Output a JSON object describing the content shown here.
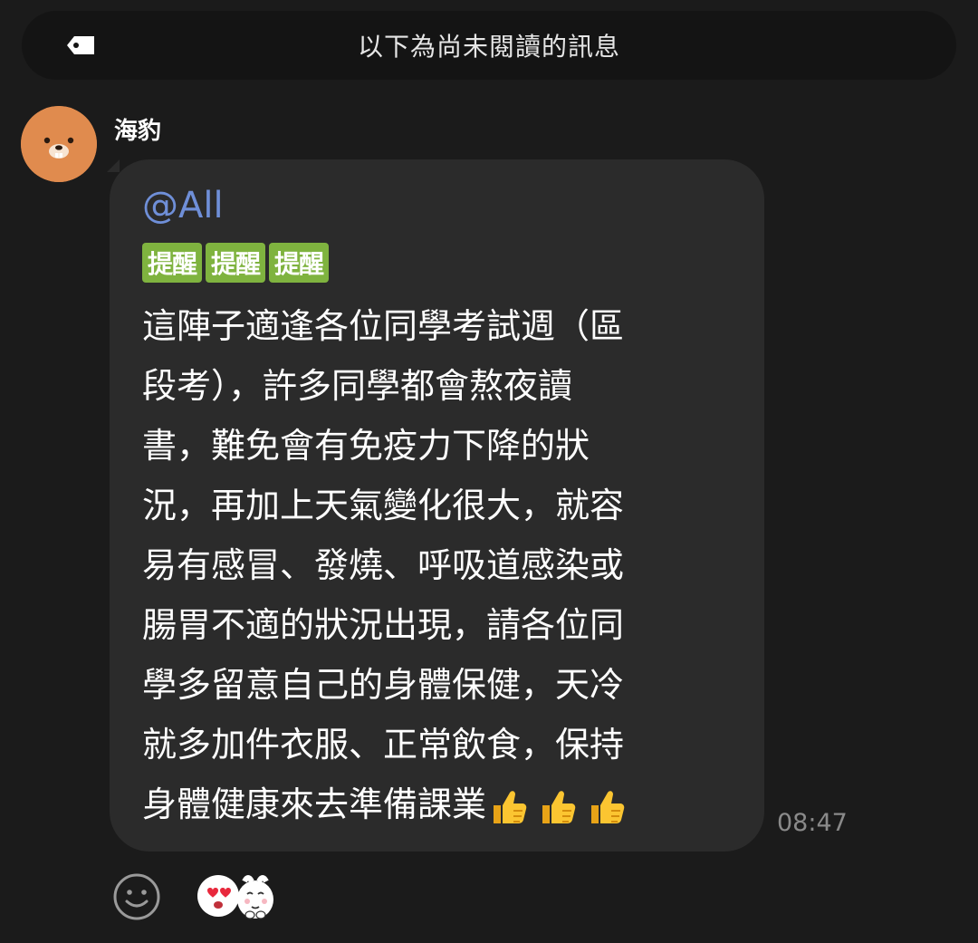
{
  "unread_banner": {
    "text": "以下為尚未閱讀的訊息",
    "icon": "tag-icon"
  },
  "message": {
    "sender": "海豹",
    "avatar_icon": "seal-avatar",
    "mention": "@All",
    "reminder_badges": [
      "提醒",
      "提醒",
      "提醒"
    ],
    "body_lines": [
      "這陣子適逢各位同學考試週（區",
      "段考），許多同學都會熬夜讀",
      "書，難免會有免疫力下降的狀",
      "況，再加上天氣變化很大，就容",
      "易有感冒、發燒、呼吸道感染或",
      "腸胃不適的狀況出現，請各位同",
      "學多留意自己的身體保健，天冷",
      "就多加件衣服、正常飲食，保持",
      "身體健康來去準備課業"
    ],
    "trailing_emoji": [
      "thumbs-up-icon",
      "thumbs-up-icon",
      "thumbs-up-icon"
    ],
    "time": "08:47"
  },
  "reactions": {
    "add_icon": "smiley-icon",
    "sticker_icons": [
      "heart-eyes-sticker-icon",
      "shy-bunny-sticker-icon"
    ]
  },
  "colors": {
    "background": "#1b1b1b",
    "bubble": "#2b2b2b",
    "mention": "#6f8fd8",
    "badge": "#7fb33f",
    "avatar": "#e08b4e"
  }
}
